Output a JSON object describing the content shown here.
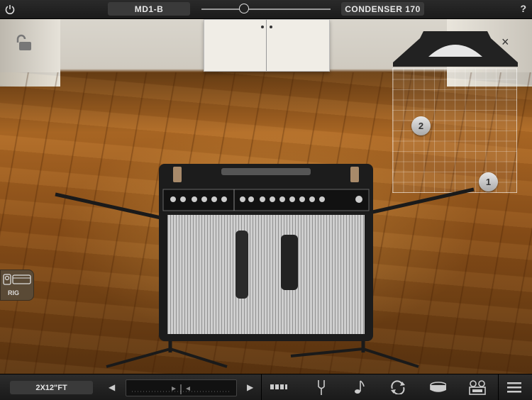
{
  "top_bar": {
    "mic_1": "MD1-B",
    "mic_2": "CONDENSER 170",
    "help": "?"
  },
  "room": {
    "close": "×",
    "positions": [
      {
        "label": "2"
      },
      {
        "label": "1"
      }
    ]
  },
  "rig_button": {
    "label": "RIG"
  },
  "bottom_bar": {
    "cabinet": "2X12\"FT"
  }
}
